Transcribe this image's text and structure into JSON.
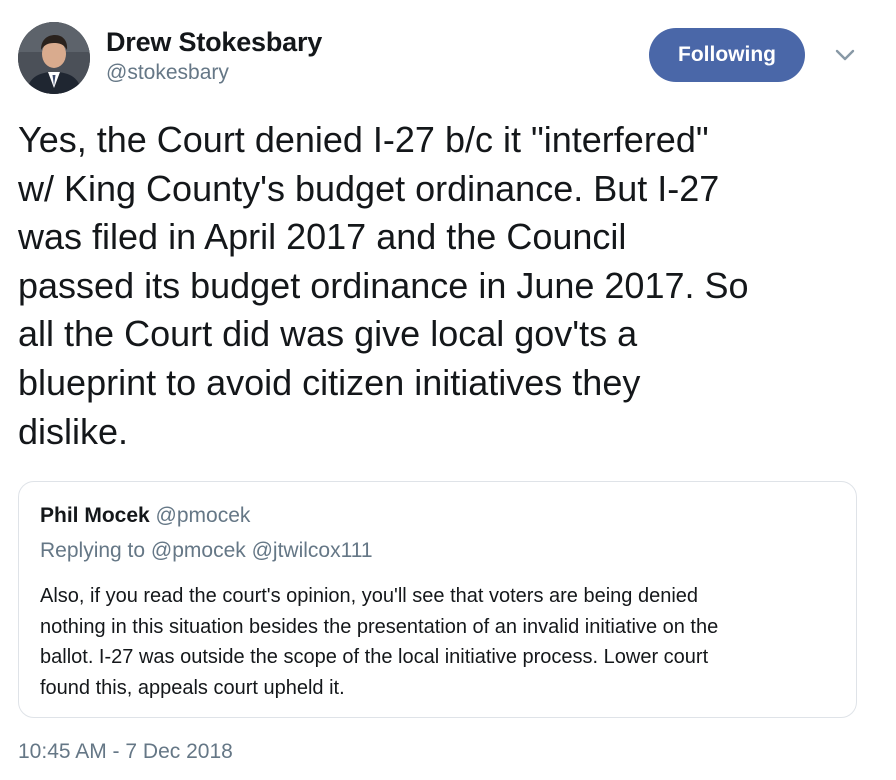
{
  "tweet": {
    "author": {
      "name": "Drew Stokesbary",
      "handle": "@stokesbary"
    },
    "follow_button_label": "Following",
    "text": "Yes, the Court denied I-27 b/c it \"interfered\"\nw/ King County's budget ordinance. But I-27\nwas filed in April 2017 and the Council\npassed its budget ordinance in June 2017. So\nall the Court did was give local gov'ts a\nblueprint to avoid citizen initiatives they\ndislike.",
    "quoted": {
      "author_name": "Phil Mocek",
      "author_handle": "@pmocek",
      "replying_to": "Replying to @pmocek @jtwilcox111",
      "text": "Also, if you read the court's opinion, you'll see that voters are being denied\nnothing in this situation besides the presentation of an invalid initiative on the\nballot. I-27 was outside the scope of the local initiative process. Lower court\nfound this, appeals court upheld it."
    },
    "timestamp": "10:45 AM - 7 Dec 2018"
  },
  "colors": {
    "follow_button_bg": "#4a67a8",
    "secondary_text": "#657786",
    "primary_text": "#14171a",
    "card_border": "#dfe3e8"
  },
  "icons": {
    "more_menu": "chevron-down-icon"
  }
}
